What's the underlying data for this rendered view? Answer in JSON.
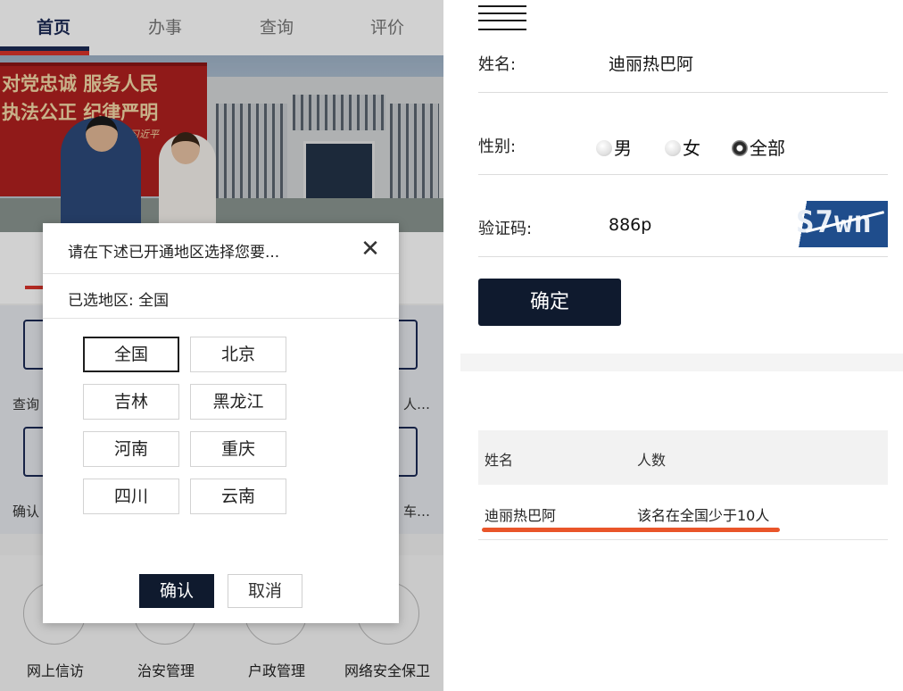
{
  "left": {
    "nav": {
      "tabs": [
        "首页",
        "办事",
        "查询",
        "评价"
      ],
      "active_index": 0
    },
    "banner": {
      "slogan_line1": "对党忠诚  服务人民",
      "slogan_line2": "执法公正  纪律严明",
      "signature": "习近平"
    },
    "services": {
      "row1_left": "查询",
      "row1_right": "人…",
      "row2_left": "确认",
      "row2_right": "车…"
    },
    "bottom_nav": [
      "网上信访",
      "治安管理",
      "户政管理",
      "网络安全保卫"
    ],
    "dialog": {
      "title": "请在下述已开通地区选择您要...",
      "close_glyph": "✕",
      "selected_label": "已选地区: 全国",
      "regions": [
        "全国",
        "北京",
        "吉林",
        "黑龙江",
        "河南",
        "重庆",
        "四川",
        "云南"
      ],
      "selected_region": "全国",
      "confirm": "确认",
      "cancel": "取消"
    }
  },
  "right": {
    "form": {
      "name_label": "姓名:",
      "name_value": "迪丽热巴阿",
      "gender_label": "性别:",
      "gender_options": [
        "男",
        "女",
        "全部"
      ],
      "gender_selected": "全部",
      "captcha_label": "验证码:",
      "captcha_value": "886p",
      "captcha_image_text": "S7wn",
      "submit": "确定"
    },
    "results": {
      "headers": [
        "姓名",
        "人数"
      ],
      "rows": [
        [
          "迪丽热巴阿",
          "该名在全国少于10人"
        ]
      ],
      "highlight_color": "#e9552a"
    }
  },
  "colors": {
    "navy": "#0f1a2e",
    "brand": "#1c2a55",
    "red": "#d9342b"
  }
}
